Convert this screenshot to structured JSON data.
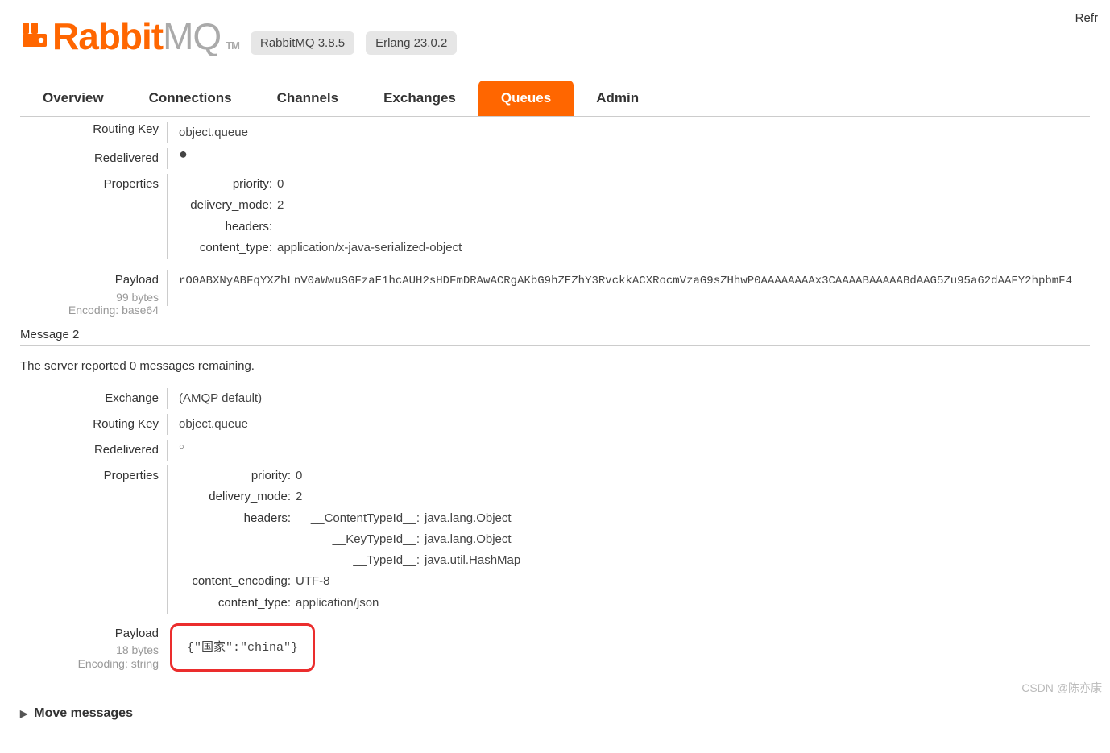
{
  "header": {
    "logo_text_1": "Rabbit",
    "logo_text_2": "MQ",
    "tm": "TM",
    "version_badge": "RabbitMQ 3.8.5",
    "erlang_badge": "Erlang 23.0.2",
    "refresh_partial": "Refr"
  },
  "nav": {
    "items": [
      {
        "label": "Overview",
        "active": false
      },
      {
        "label": "Connections",
        "active": false
      },
      {
        "label": "Channels",
        "active": false
      },
      {
        "label": "Exchanges",
        "active": false
      },
      {
        "label": "Queues",
        "active": true
      },
      {
        "label": "Admin",
        "active": false
      }
    ]
  },
  "message1": {
    "labels": {
      "routing_key": "Routing Key",
      "redelivered": "Redelivered",
      "properties": "Properties",
      "payload": "Payload"
    },
    "routing_key": "object.queue",
    "redelivered_symbol": "●",
    "properties": {
      "priority_k": "priority:",
      "priority_v": "0",
      "delivery_mode_k": "delivery_mode:",
      "delivery_mode_v": "2",
      "headers_k": "headers:",
      "headers_v": "",
      "content_type_k": "content_type:",
      "content_type_v": "application/x-java-serialized-object"
    },
    "payload_bytes": "99 bytes",
    "payload_encoding": "Encoding: base64",
    "payload_value": "rO0ABXNyABFqYXZhLnV0aWwuSGFzaE1hcAUH2sHDFmDRAwACRgAKbG9hZEZhY3RvckkACXRocmVzaG9sZHhwP0AAAAAAAAx3CAAAABAAAAABdAAG5Zu95a62dAAFY2hpbmF4"
  },
  "divider": {
    "message2_label": "Message 2"
  },
  "server_remaining": "The server reported 0 messages remaining.",
  "message2": {
    "labels": {
      "exchange": "Exchange",
      "routing_key": "Routing Key",
      "redelivered": "Redelivered",
      "properties": "Properties",
      "payload": "Payload"
    },
    "exchange": "(AMQP default)",
    "routing_key": "object.queue",
    "redelivered_symbol": "○",
    "properties": {
      "priority_k": "priority:",
      "priority_v": "0",
      "delivery_mode_k": "delivery_mode:",
      "delivery_mode_v": "2",
      "headers_k": "headers:",
      "headers": [
        {
          "k": "__ContentTypeId__:",
          "v": "java.lang.Object"
        },
        {
          "k": "__KeyTypeId__:",
          "v": "java.lang.Object"
        },
        {
          "k": "__TypeId__:",
          "v": "java.util.HashMap"
        }
      ],
      "content_encoding_k": "content_encoding:",
      "content_encoding_v": "UTF-8",
      "content_type_k": "content_type:",
      "content_type_v": "application/json"
    },
    "payload_bytes": "18 bytes",
    "payload_encoding": "Encoding: string",
    "payload_value": "{\"国家\":\"china\"}"
  },
  "move_messages": {
    "label": "Move messages"
  },
  "watermark": "CSDN @陈亦康"
}
